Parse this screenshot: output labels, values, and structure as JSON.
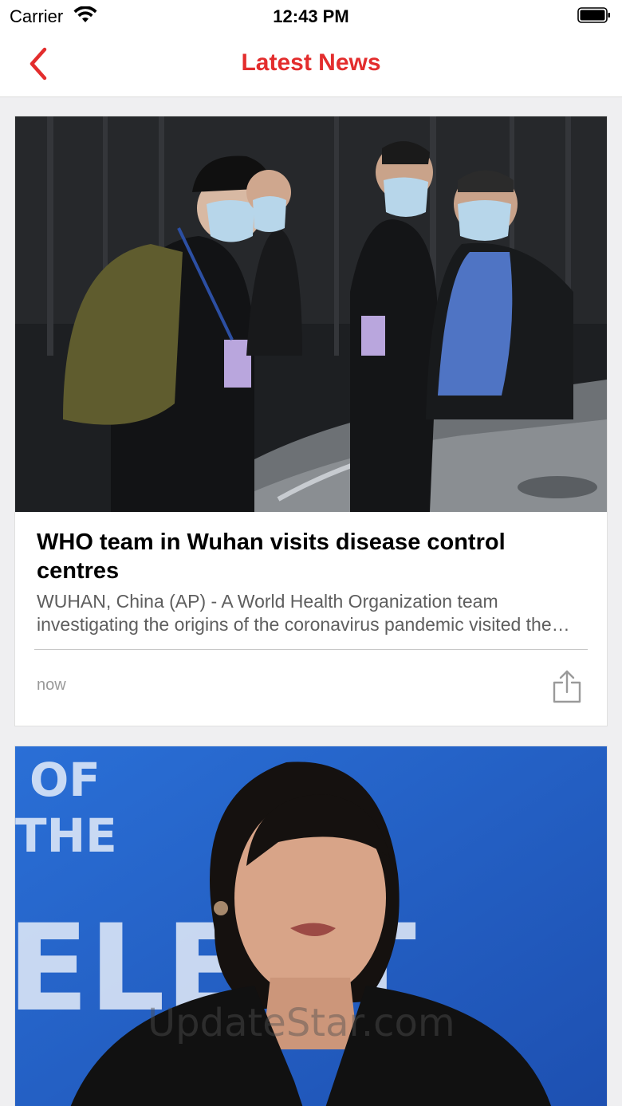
{
  "status_bar": {
    "carrier": "Carrier",
    "time": "12:43 PM"
  },
  "nav": {
    "title": "Latest News",
    "back_icon": "chevron-left-icon",
    "accent_color": "#e32d2d"
  },
  "articles": [
    {
      "headline": "WHO team in Wuhan visits disease control centres",
      "summary": "WUHAN, China (AP) - A World Health Organization team investigating the origins of the coronavirus pandemic visited the Hubei provincial disease control centre",
      "time": "now",
      "share_icon": "share-icon",
      "image": "photo of masked WHO team members walking past a car at night"
    },
    {
      "image": "photo of a woman with dark hair speaking in front of a blue backdrop"
    }
  ],
  "watermark": "UpdateStar.com"
}
